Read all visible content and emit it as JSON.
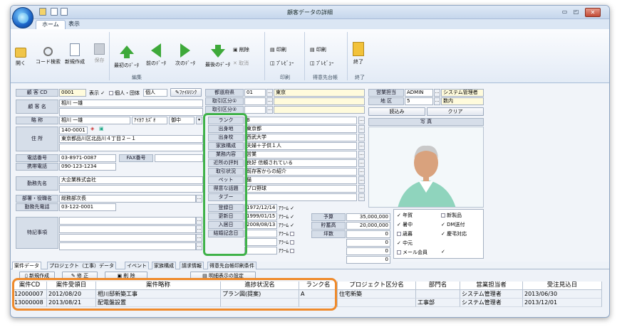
{
  "window": {
    "title": "顧客データの詳細",
    "min": "▭",
    "max": "◰",
    "close": "✕"
  },
  "tabs": [
    "ホーム",
    "表示"
  ],
  "ribbon": {
    "open": "開く",
    "code_search": "コード検索",
    "new": "新規作成",
    "save": "保存",
    "first": "最初のﾃﾞｰﾀ",
    "prev": "前のﾃﾞｰﾀ",
    "next": "次のﾃﾞｰﾀ",
    "last": "最後のﾃﾞｰﾀ",
    "delete": "削除",
    "cancel": "取消",
    "print": "印刷",
    "preview": "ﾌﾟﾚﾋﾞｭｰ",
    "print2": "印刷",
    "preview2": "ﾌﾟﾚﾋﾞｭｰ",
    "exit": "終了",
    "group_edit": "編集",
    "group_print": "印刷",
    "group_tokui": "得意先台帳",
    "group_exit": "終了"
  },
  "left": {
    "code_label": "顧 客 CD",
    "code": "0001",
    "display_label": "表示",
    "kojin": "個人・団体",
    "kojin_val": "個人",
    "file_link": "ﾌｧｲﾙﾘﾝｸ",
    "name_label": "顧 客 名",
    "name": "相川 一雄",
    "short_label": "略 称",
    "short": "相川 一雄",
    "kana_label": "ｱｲｶﾜ ｶｽﾞｵ",
    "honor": "御中",
    "address_label": "住 所",
    "zip": "140-0001",
    "address": "東京都品川区北品川４丁目２－１",
    "tel_label": "電話番号",
    "tel": "03-8971-0087",
    "fax_label": "FAX番号",
    "mobile_label": "携帯電話",
    "mobile": "090-123-1234",
    "company_label": "勤務先名",
    "company": "大企業株式会社",
    "dept_label": "部署・役職名",
    "dept": "総務部次長",
    "work_tel_label": "勤務先電話",
    "work_tel": "03-122-0001",
    "notes_label": "特記事項"
  },
  "mid": {
    "pref_label": "都道府県",
    "pref_code": "01",
    "pref": "東京",
    "cat1_label": "取引区分①",
    "cat2_label": "取引区分②",
    "rank_label": "ランク",
    "rank": "B",
    "birthplace_label": "出身地",
    "birthplace": "東京都",
    "school_label": "出身校",
    "school": "西武大学",
    "family_label": "家族構成",
    "family": "夫婦＋子供１人",
    "job_label": "業務内容",
    "job": "営業",
    "reputation_label": "近所の評判",
    "reputation": "良好 信頼されている",
    "status_label": "取引状況",
    "status": "既存客からの紹介",
    "pet_label": "ペット",
    "pet": "猫",
    "topic_label": "得意な話題",
    "topic": "プロ野球",
    "taboo_label": "タブー",
    "reg_label": "登録日",
    "reg": "1972/12/14",
    "upd_label": "更新日",
    "upd": "1999/01/15",
    "join_label": "入居日",
    "join": "2008/08/13",
    "anniv_label": "結婚記念日",
    "alarm": "ｱﾗｰﾑ",
    "budget_label": "予算",
    "budget": "35,000,000",
    "savings_label": "貯蓄高",
    "savings": "20,000,000",
    "tsubo_label": "坪数",
    "zero": "0"
  },
  "right": {
    "sales_label": "営業担当",
    "sales_code": "ADMIN",
    "sales": "システム管理者",
    "region_label": "地 区",
    "region_code": "5",
    "region": "数内",
    "load_btn": "読込み",
    "clear_btn": "クリア",
    "photo_label": "写 真",
    "checks": [
      {
        "label": "年賀",
        "checked": true
      },
      {
        "label": "新製品",
        "checked": false
      },
      {
        "label": "暑中",
        "checked": true
      },
      {
        "label": "DM送付",
        "checked": true
      },
      {
        "label": "歳暮",
        "checked": false
      },
      {
        "label": "慶弔対応",
        "checked": true
      },
      {
        "label": "中元",
        "checked": true
      },
      {
        "label": "",
        "checked": false
      },
      {
        "label": "メール会員",
        "checked": false
      },
      {
        "label": "",
        "checked": true
      }
    ]
  },
  "btabs": [
    "案件データ",
    "プロジェクト（工事）データ",
    "イベント",
    "家族構成",
    "請求情報",
    "得意先台帳印刷条件"
  ],
  "grid_toolbar": {
    "new": "新規作成",
    "edit": "修 正",
    "del": "削 除",
    "detail": "明細表示の設定"
  },
  "grid": {
    "headers": [
      "案件CD",
      "案件受領日",
      "案件略称",
      "進捗状況名",
      "ランク名",
      "プロジェクト区分名",
      "部門名",
      "営業担当者",
      "受注見込日"
    ],
    "rows": [
      [
        "12000007",
        "2012/08/20",
        "相川邸新築工事",
        "プラン図(提案)",
        "A",
        "住宅新築",
        "",
        "システム管理者",
        "2013/06/30"
      ],
      [
        "13000008",
        "2013/08/21",
        "配電盤設置",
        "",
        "",
        "",
        "工事部",
        "システム管理者",
        "2013/12/01"
      ]
    ]
  }
}
